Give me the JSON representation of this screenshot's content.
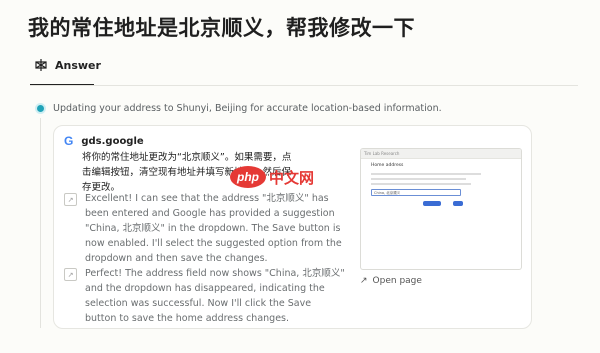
{
  "query": {
    "title": "我的常住地址是北京顺义，帮我修改一下"
  },
  "tabs": {
    "answer_label": "Answer"
  },
  "step": {
    "text": "Updating your address to Shunyi, Beijing for accurate location-based information."
  },
  "source": {
    "name": "gds.google",
    "text": "将你的常住地址更改为“北京顺义”。如果需要，点击编辑按钮，清空现有地址并填写新地址，然后保存更改。"
  },
  "log_items": [
    {
      "text": "Excellent! I can see that the address \"北京顺义\" has been entered and Google has provided a suggestion \"China, 北京顺义\" in the dropdown. The Save button is now enabled. I'll select the suggested option from the dropdown and then save the changes."
    },
    {
      "text": "Perfect! The address field now shows \"China, 北京顺义\" and the dropdown has disappeared, indicating the selection was successful. Now I'll click the Save button to save the home address changes."
    }
  ],
  "preview": {
    "tab_label": "Tim Lab Research",
    "heading": "Home address",
    "input_value": "China, 北京顺义",
    "open_page_label": "Open page"
  },
  "watermark": {
    "brand": "php",
    "suffix": "中文网"
  }
}
